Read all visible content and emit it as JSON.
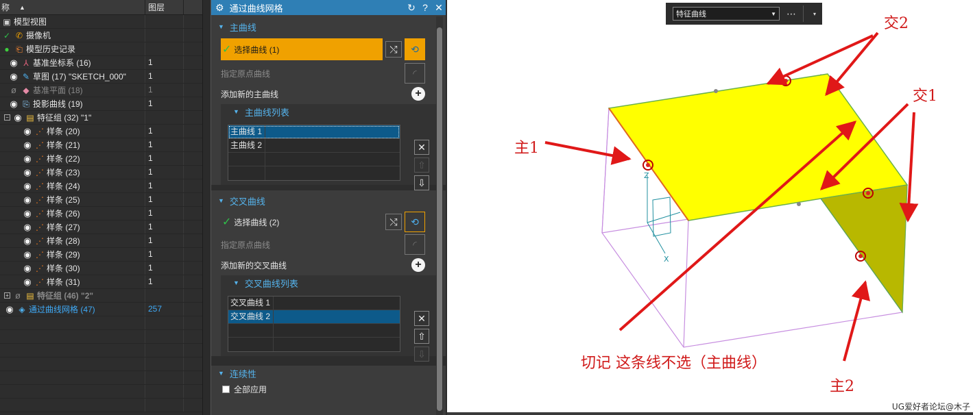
{
  "navigator": {
    "columns": [
      "称",
      "图层"
    ],
    "rows": [
      {
        "label": "模型视图",
        "layer": "",
        "indent": 0,
        "icon": "model-view-icon"
      },
      {
        "label": "摄像机",
        "layer": "",
        "indent": 0,
        "icon": "camera-icon"
      },
      {
        "label": "模型历史记录",
        "layer": "",
        "indent": 0,
        "icon": "history-icon"
      },
      {
        "label": "基准坐标系 (16)",
        "layer": "1",
        "indent": 1,
        "icon": "csys-icon"
      },
      {
        "label": "草图 (17) \"SKETCH_000\"",
        "layer": "1",
        "indent": 1,
        "icon": "sketch-icon"
      },
      {
        "label": "基准平面 (18)",
        "layer": "1",
        "indent": 1,
        "icon": "datum-plane-icon",
        "hidden": true
      },
      {
        "label": "投影曲线 (19)",
        "layer": "1",
        "indent": 1,
        "icon": "projected-curve-icon"
      },
      {
        "label": "特征组 (32) \"1\"",
        "layer": "",
        "indent": 1,
        "icon": "feature-group-icon",
        "expander": "minus"
      },
      {
        "label": "样条 (20)",
        "layer": "1",
        "indent": 2,
        "icon": "spline-icon"
      },
      {
        "label": "样条 (21)",
        "layer": "1",
        "indent": 2,
        "icon": "spline-icon"
      },
      {
        "label": "样条 (22)",
        "layer": "1",
        "indent": 2,
        "icon": "spline-icon"
      },
      {
        "label": "样条 (23)",
        "layer": "1",
        "indent": 2,
        "icon": "spline-icon"
      },
      {
        "label": "样条 (24)",
        "layer": "1",
        "indent": 2,
        "icon": "spline-icon"
      },
      {
        "label": "样条 (25)",
        "layer": "1",
        "indent": 2,
        "icon": "spline-icon"
      },
      {
        "label": "样条 (26)",
        "layer": "1",
        "indent": 2,
        "icon": "spline-icon"
      },
      {
        "label": "样条 (27)",
        "layer": "1",
        "indent": 2,
        "icon": "spline-icon"
      },
      {
        "label": "样条 (28)",
        "layer": "1",
        "indent": 2,
        "icon": "spline-icon"
      },
      {
        "label": "样条 (29)",
        "layer": "1",
        "indent": 2,
        "icon": "spline-icon"
      },
      {
        "label": "样条 (30)",
        "layer": "1",
        "indent": 2,
        "icon": "spline-icon"
      },
      {
        "label": "样条 (31)",
        "layer": "1",
        "indent": 2,
        "icon": "spline-icon"
      },
      {
        "label": "特征组 (46) \"2\"",
        "layer": "",
        "indent": 0,
        "icon": "feature-group-icon",
        "expander": "plus",
        "hidden": true
      },
      {
        "label": "通过曲线网格 (47)",
        "layer": "257",
        "indent": 0,
        "icon": "through-curve-mesh-icon",
        "active": true
      }
    ]
  },
  "dialog": {
    "title": "通过曲线网格",
    "primary": {
      "header": "主曲线",
      "select_label": "选择曲线 (1)",
      "origin_label": "指定原点曲线",
      "add_label": "添加新的主曲线",
      "list_header": "主曲线列表",
      "items": [
        "主曲线 1",
        "主曲线 2"
      ]
    },
    "cross": {
      "header": "交叉曲线",
      "select_label": "选择曲线 (2)",
      "origin_label": "指定原点曲线",
      "add_label": "添加新的交叉曲线",
      "list_header": "交叉曲线列表",
      "items": [
        "交叉曲线 1",
        "交叉曲线 2"
      ]
    },
    "continuity": {
      "header": "连续性",
      "apply_all_label": "全部应用"
    }
  },
  "viewport": {
    "filter_value": "特征曲线",
    "watermark": "UG爱好者论坛@木子",
    "annotations": {
      "jiao2": "交2",
      "jiao1": "交1",
      "zhu1": "主1",
      "zhu2": "主2",
      "note": "切记  这条线不选（主曲线）"
    },
    "axes": {
      "z": "Z",
      "x": "X"
    },
    "colors": {
      "surface": "#ffff00",
      "surface_shadow": "#b8b800",
      "arrow": "#e01818",
      "wire": "#c78ee0"
    }
  }
}
